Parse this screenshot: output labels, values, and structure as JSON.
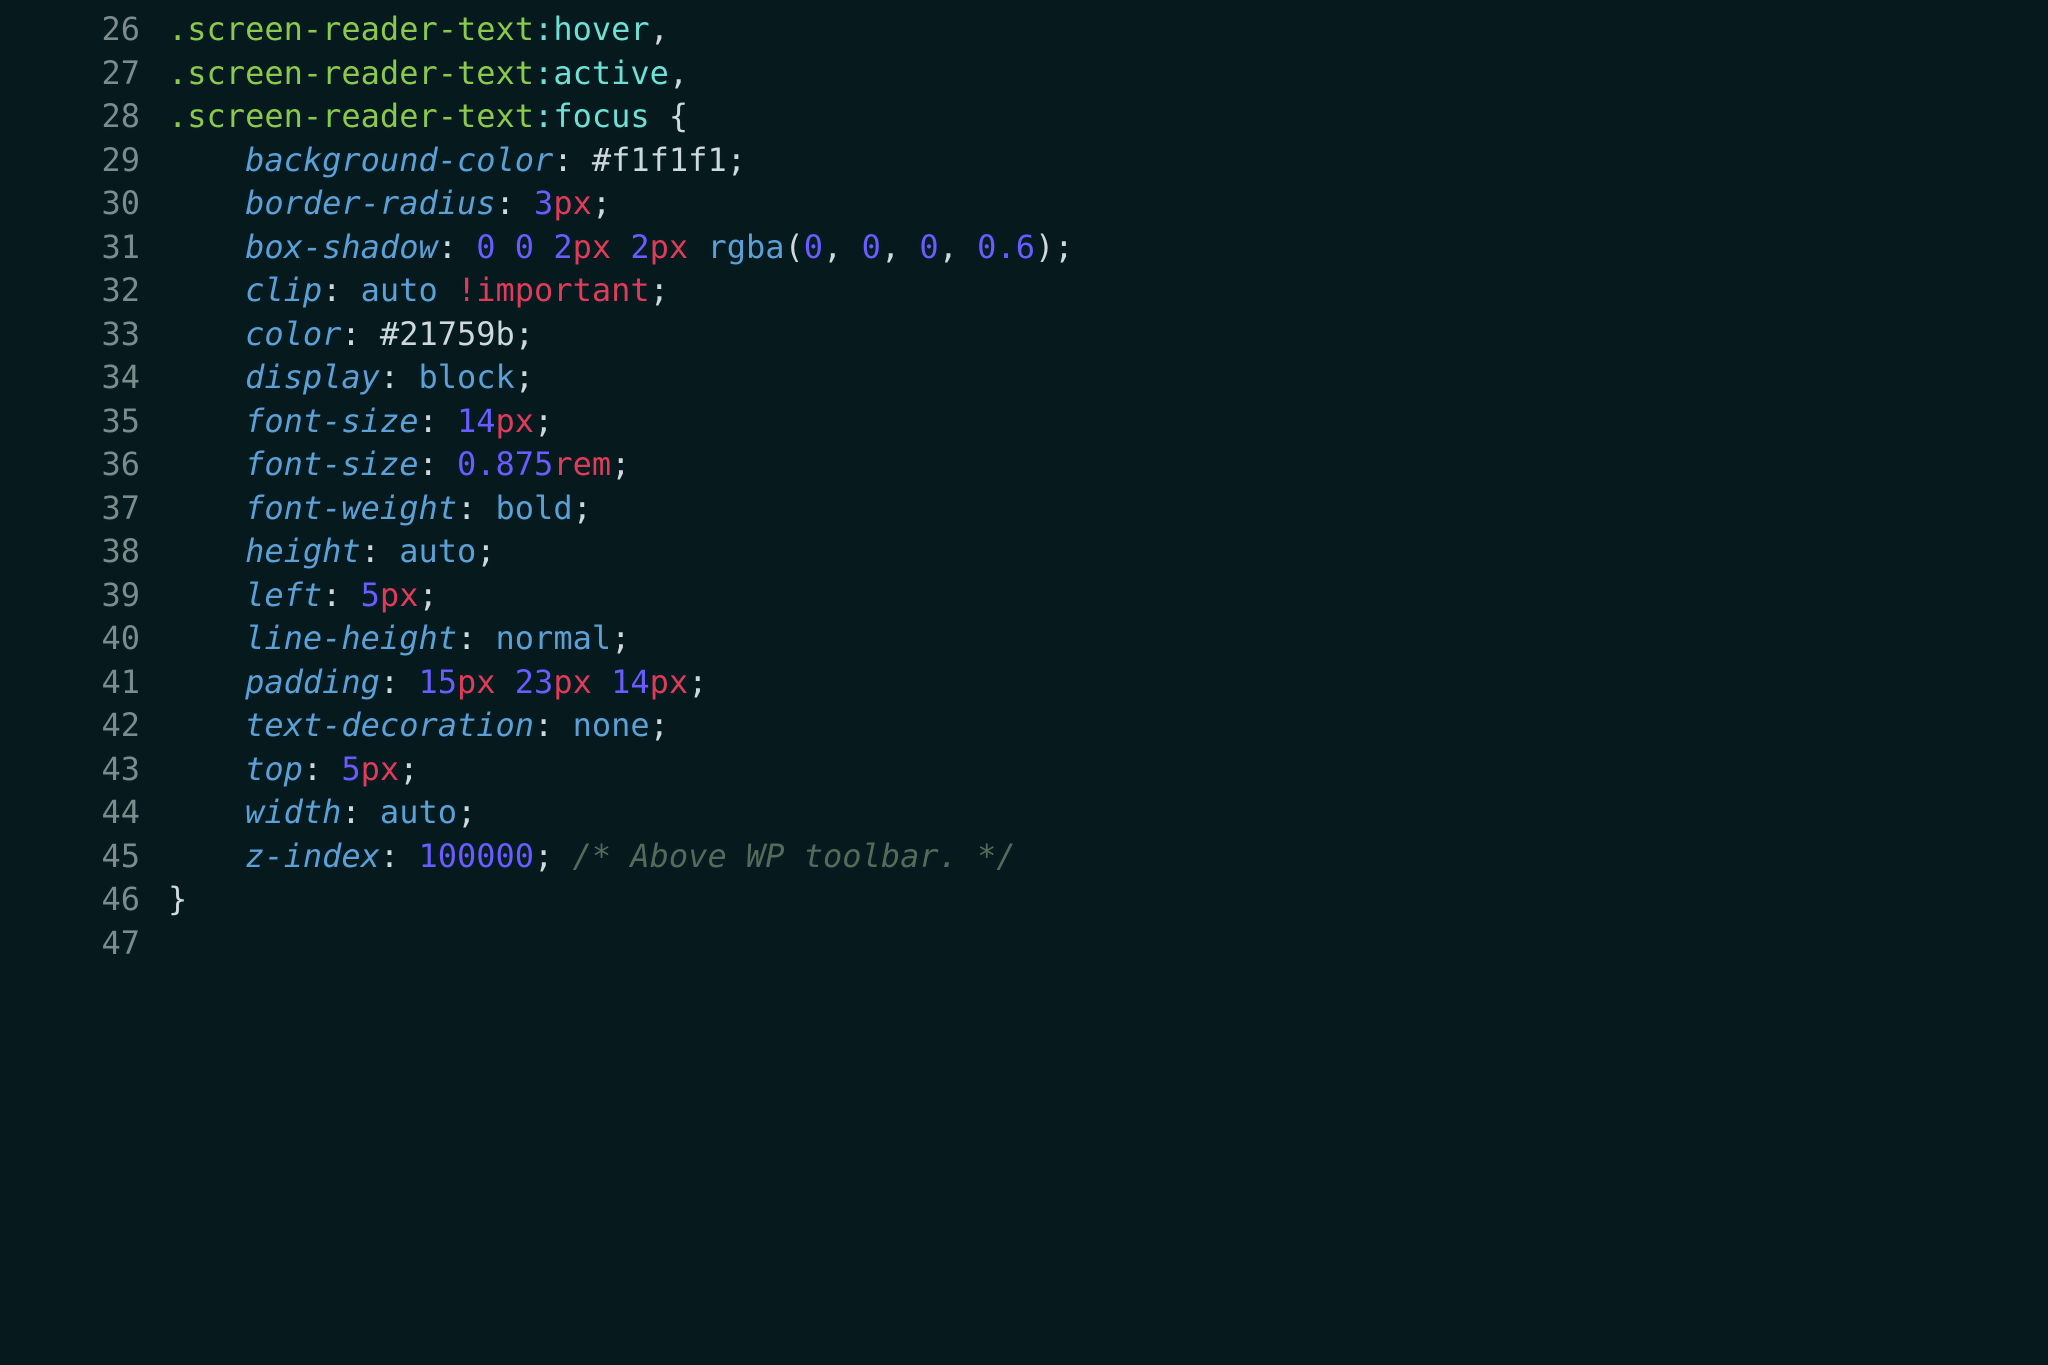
{
  "lines": [
    {
      "num": "26",
      "indent": 0,
      "tokens": [
        {
          "cls": "sel",
          "text": ".screen-reader-text"
        },
        {
          "cls": "pseudo",
          "text": ":hover"
        },
        {
          "cls": "punct",
          "text": ","
        }
      ]
    },
    {
      "num": "27",
      "indent": 0,
      "tokens": [
        {
          "cls": "sel",
          "text": ".screen-reader-text"
        },
        {
          "cls": "pseudo",
          "text": ":active"
        },
        {
          "cls": "punct",
          "text": ","
        }
      ]
    },
    {
      "num": "28",
      "indent": 0,
      "tokens": [
        {
          "cls": "sel",
          "text": ".screen-reader-text"
        },
        {
          "cls": "pseudo",
          "text": ":focus"
        },
        {
          "cls": "punct",
          "text": " {"
        }
      ]
    },
    {
      "num": "29",
      "indent": 1,
      "tokens": [
        {
          "cls": "prop",
          "text": "background-color"
        },
        {
          "cls": "punct",
          "text": ": "
        },
        {
          "cls": "hex",
          "text": "#f1f1f1"
        },
        {
          "cls": "punct",
          "text": ";"
        }
      ]
    },
    {
      "num": "30",
      "indent": 1,
      "tokens": [
        {
          "cls": "prop",
          "text": "border-radius"
        },
        {
          "cls": "punct",
          "text": ": "
        },
        {
          "cls": "number",
          "text": "3"
        },
        {
          "cls": "unit",
          "text": "px"
        },
        {
          "cls": "punct",
          "text": ";"
        }
      ]
    },
    {
      "num": "31",
      "indent": 1,
      "tokens": [
        {
          "cls": "prop",
          "text": "box-shadow"
        },
        {
          "cls": "punct",
          "text": ": "
        },
        {
          "cls": "number",
          "text": "0"
        },
        {
          "cls": "punct",
          "text": " "
        },
        {
          "cls": "number",
          "text": "0"
        },
        {
          "cls": "punct",
          "text": " "
        },
        {
          "cls": "number",
          "text": "2"
        },
        {
          "cls": "unit",
          "text": "px"
        },
        {
          "cls": "punct",
          "text": " "
        },
        {
          "cls": "number",
          "text": "2"
        },
        {
          "cls": "unit",
          "text": "px"
        },
        {
          "cls": "punct",
          "text": " "
        },
        {
          "cls": "fname",
          "text": "rgba"
        },
        {
          "cls": "punct",
          "text": "("
        },
        {
          "cls": "number",
          "text": "0"
        },
        {
          "cls": "punct",
          "text": ", "
        },
        {
          "cls": "number",
          "text": "0"
        },
        {
          "cls": "punct",
          "text": ", "
        },
        {
          "cls": "number",
          "text": "0"
        },
        {
          "cls": "punct",
          "text": ", "
        },
        {
          "cls": "number",
          "text": "0.6"
        },
        {
          "cls": "punct",
          "text": ");"
        }
      ]
    },
    {
      "num": "32",
      "indent": 1,
      "tokens": [
        {
          "cls": "prop",
          "text": "clip"
        },
        {
          "cls": "punct",
          "text": ": "
        },
        {
          "cls": "keyword",
          "text": "auto"
        },
        {
          "cls": "punct",
          "text": " "
        },
        {
          "cls": "important",
          "text": "!important"
        },
        {
          "cls": "punct",
          "text": ";"
        }
      ]
    },
    {
      "num": "33",
      "indent": 1,
      "tokens": [
        {
          "cls": "prop",
          "text": "color"
        },
        {
          "cls": "punct",
          "text": ": "
        },
        {
          "cls": "hex",
          "text": "#21759b"
        },
        {
          "cls": "punct",
          "text": ";"
        }
      ]
    },
    {
      "num": "34",
      "indent": 1,
      "tokens": [
        {
          "cls": "prop",
          "text": "display"
        },
        {
          "cls": "punct",
          "text": ": "
        },
        {
          "cls": "keyword",
          "text": "block"
        },
        {
          "cls": "punct",
          "text": ";"
        }
      ]
    },
    {
      "num": "35",
      "indent": 1,
      "tokens": [
        {
          "cls": "prop",
          "text": "font-size"
        },
        {
          "cls": "punct",
          "text": ": "
        },
        {
          "cls": "number",
          "text": "14"
        },
        {
          "cls": "unit",
          "text": "px"
        },
        {
          "cls": "punct",
          "text": ";"
        }
      ]
    },
    {
      "num": "36",
      "indent": 1,
      "tokens": [
        {
          "cls": "prop",
          "text": "font-size"
        },
        {
          "cls": "punct",
          "text": ": "
        },
        {
          "cls": "number",
          "text": "0.875"
        },
        {
          "cls": "unit",
          "text": "rem"
        },
        {
          "cls": "punct",
          "text": ";"
        }
      ]
    },
    {
      "num": "37",
      "indent": 1,
      "tokens": [
        {
          "cls": "prop",
          "text": "font-weight"
        },
        {
          "cls": "punct",
          "text": ": "
        },
        {
          "cls": "keyword",
          "text": "bold"
        },
        {
          "cls": "punct",
          "text": ";"
        }
      ]
    },
    {
      "num": "38",
      "indent": 1,
      "tokens": [
        {
          "cls": "prop",
          "text": "height"
        },
        {
          "cls": "punct",
          "text": ": "
        },
        {
          "cls": "keyword",
          "text": "auto"
        },
        {
          "cls": "punct",
          "text": ";"
        }
      ]
    },
    {
      "num": "39",
      "indent": 1,
      "tokens": [
        {
          "cls": "prop",
          "text": "left"
        },
        {
          "cls": "punct",
          "text": ": "
        },
        {
          "cls": "number",
          "text": "5"
        },
        {
          "cls": "unit",
          "text": "px"
        },
        {
          "cls": "punct",
          "text": ";"
        }
      ]
    },
    {
      "num": "40",
      "indent": 1,
      "tokens": [
        {
          "cls": "prop",
          "text": "line-height"
        },
        {
          "cls": "punct",
          "text": ": "
        },
        {
          "cls": "keyword",
          "text": "normal"
        },
        {
          "cls": "punct",
          "text": ";"
        }
      ]
    },
    {
      "num": "41",
      "indent": 1,
      "tokens": [
        {
          "cls": "prop",
          "text": "padding"
        },
        {
          "cls": "punct",
          "text": ": "
        },
        {
          "cls": "number",
          "text": "15"
        },
        {
          "cls": "unit",
          "text": "px"
        },
        {
          "cls": "punct",
          "text": " "
        },
        {
          "cls": "number",
          "text": "23"
        },
        {
          "cls": "unit",
          "text": "px"
        },
        {
          "cls": "punct",
          "text": " "
        },
        {
          "cls": "number",
          "text": "14"
        },
        {
          "cls": "unit",
          "text": "px"
        },
        {
          "cls": "punct",
          "text": ";"
        }
      ]
    },
    {
      "num": "42",
      "indent": 1,
      "tokens": [
        {
          "cls": "prop",
          "text": "text-decoration"
        },
        {
          "cls": "punct",
          "text": ": "
        },
        {
          "cls": "keyword",
          "text": "none"
        },
        {
          "cls": "punct",
          "text": ";"
        }
      ]
    },
    {
      "num": "43",
      "indent": 1,
      "tokens": [
        {
          "cls": "prop",
          "text": "top"
        },
        {
          "cls": "punct",
          "text": ": "
        },
        {
          "cls": "number",
          "text": "5"
        },
        {
          "cls": "unit",
          "text": "px"
        },
        {
          "cls": "punct",
          "text": ";"
        }
      ]
    },
    {
      "num": "44",
      "indent": 1,
      "tokens": [
        {
          "cls": "prop",
          "text": "width"
        },
        {
          "cls": "punct",
          "text": ": "
        },
        {
          "cls": "keyword",
          "text": "auto"
        },
        {
          "cls": "punct",
          "text": ";"
        }
      ]
    },
    {
      "num": "45",
      "indent": 1,
      "tokens": [
        {
          "cls": "prop",
          "text": "z-index"
        },
        {
          "cls": "punct",
          "text": ": "
        },
        {
          "cls": "number",
          "text": "100000"
        },
        {
          "cls": "punct",
          "text": "; "
        },
        {
          "cls": "comment",
          "text": "/* Above WP toolbar. */"
        }
      ]
    },
    {
      "num": "46",
      "indent": 0,
      "tokens": [
        {
          "cls": "punct",
          "text": "}"
        }
      ]
    },
    {
      "num": "47",
      "indent": 0,
      "tokens": []
    }
  ]
}
